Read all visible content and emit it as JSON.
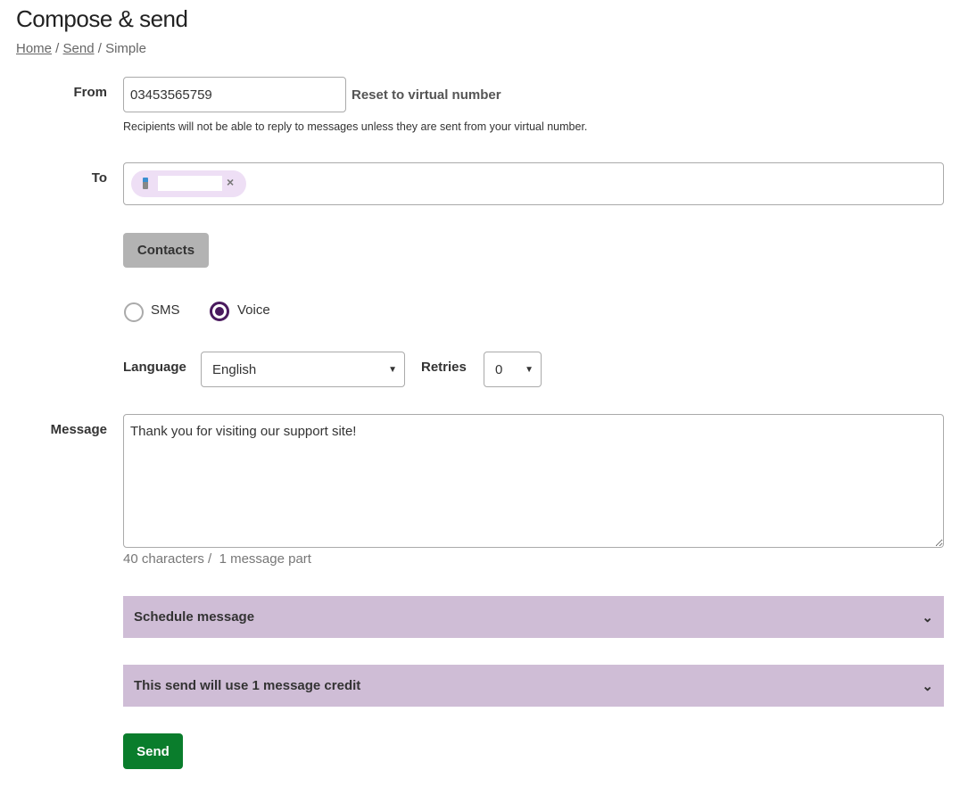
{
  "page": {
    "title": "Compose & send",
    "breadcrumb": [
      "Home",
      "Send",
      "Simple"
    ]
  },
  "from": {
    "label": "From",
    "value": "03453565759",
    "reset_label": "Reset to virtual number",
    "help": "Recipients will not be able to reply to messages unless they are sent from your virtual number."
  },
  "to": {
    "label": "To",
    "chip_remove": "×"
  },
  "contacts_label": "Contacts",
  "type": {
    "options": [
      "SMS",
      "Voice"
    ],
    "selected": "Voice"
  },
  "language": {
    "label": "Language",
    "value": "English"
  },
  "retries": {
    "label": "Retries",
    "value": "0"
  },
  "message": {
    "label": "Message",
    "value": "Thank you for visiting our support site!",
    "count": "40 characters /",
    "parts": "1 message part"
  },
  "schedule_label": "Schedule message",
  "credit_label": "This send will use 1 message credit",
  "send_label": "Send",
  "colors": {
    "accent": "#4a1a5e",
    "accordion": "#cfbdd6",
    "send": "#0a7d2c",
    "chip": "#eedff5"
  }
}
